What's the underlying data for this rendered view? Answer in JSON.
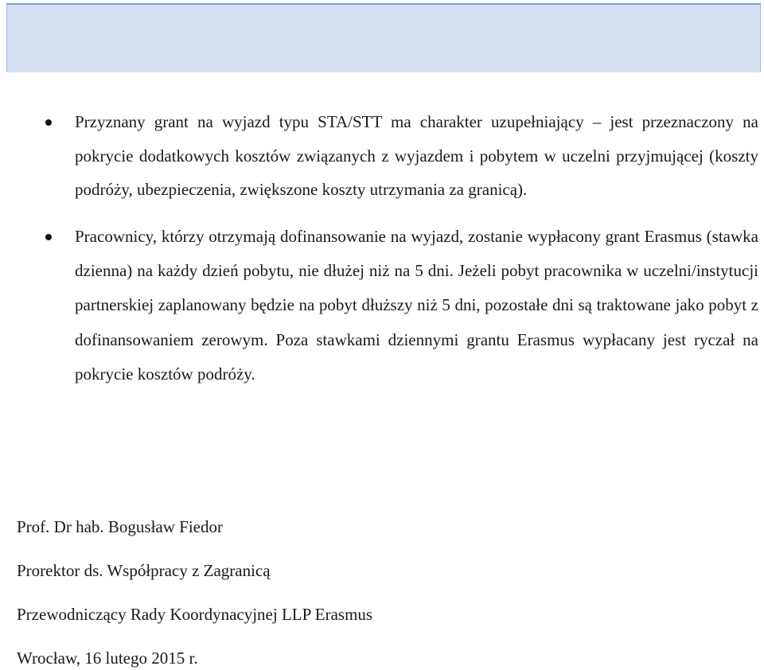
{
  "bullets": [
    {
      "text": "Przyznany grant na wyjazd typu STA/STT ma charakter uzupełniający – jest przeznaczony na pokrycie dodatkowych kosztów związanych z wyjazdem i pobytem w uczelni przyjmującej (koszty podróży, ubezpieczenia, zwiększone koszty utrzymania za granicą)."
    },
    {
      "text": "Pracownicy, którzy otrzymają dofinansowanie na wyjazd, zostanie wypłacony grant Erasmus (stawka dzienna)  na każdy dzień pobytu, nie dłużej niż na 5 dni. Jeżeli pobyt pracownika w uczelni/instytucji partnerskiej zaplanowany będzie na pobyt dłuższy niż 5 dni, pozostałe dni są traktowane jako pobyt z dofinansowaniem zerowym. Poza stawkami dziennymi grantu Erasmus wypłacany jest ryczał na pokrycie kosztów podróży."
    }
  ],
  "signature": {
    "name": "Prof. Dr hab. Bogusław Fiedor",
    "position": "Prorektor ds. Współpracy z Zagranicą",
    "role": "Przewodniczący Rady Koordynacyjnej LLP Erasmus",
    "place_date": "Wrocław, 16 lutego 2015 r."
  }
}
